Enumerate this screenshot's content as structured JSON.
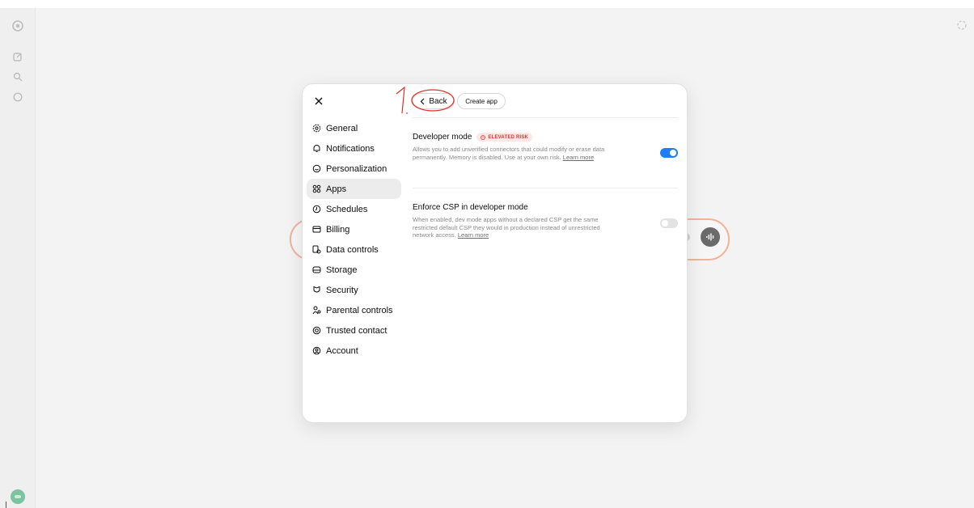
{
  "sidebar": {
    "icons": [
      "openai-logo-icon",
      "new-chat-icon",
      "search-icon",
      "chat-bubble-icon"
    ]
  },
  "settings": {
    "nav": [
      {
        "label": "General",
        "icon": "gear-icon"
      },
      {
        "label": "Notifications",
        "icon": "bell-icon"
      },
      {
        "label": "Personalization",
        "icon": "personalization-icon"
      },
      {
        "label": "Apps",
        "icon": "apps-grid-icon",
        "active": true
      },
      {
        "label": "Schedules",
        "icon": "clock-icon"
      },
      {
        "label": "Billing",
        "icon": "credit-card-icon"
      },
      {
        "label": "Data controls",
        "icon": "data-controls-icon"
      },
      {
        "label": "Storage",
        "icon": "storage-icon"
      },
      {
        "label": "Security",
        "icon": "security-icon"
      },
      {
        "label": "Parental controls",
        "icon": "parental-icon"
      },
      {
        "label": "Trusted contact",
        "icon": "lifebuoy-icon"
      },
      {
        "label": "Account",
        "icon": "account-icon"
      }
    ],
    "header": {
      "back_label": "Back",
      "create_label": "Create app",
      "annotation": "1."
    },
    "developer_mode": {
      "title": "Developer mode",
      "badge": "ELEVATED RISK",
      "description": "Allows you to add unverified connectors that could modify or erase data permanently. Memory is disabled. Use at your own risk.",
      "link": "Learn more",
      "enabled": true
    },
    "enforce_csp": {
      "title": "Enforce CSP in developer mode",
      "description": "When enabled, dev mode apps without a declared CSP get the same restricted default CSP they would in production instead of unrestricted network access.",
      "link": "Learn more",
      "enabled": false
    }
  },
  "colors": {
    "accent": "#1f7ef5",
    "risk": "#d03a2b",
    "annotation": "#d9332b"
  }
}
